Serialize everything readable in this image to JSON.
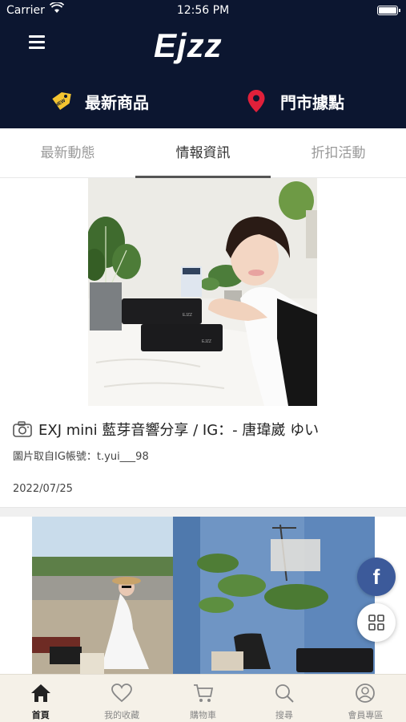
{
  "status_bar": {
    "carrier": "Carrier",
    "time": "12:56 PM"
  },
  "header": {
    "logo_text": "Ejzz",
    "quick_links": [
      {
        "label": "最新商品",
        "icon": "new-tag-icon",
        "badge": "NEW"
      },
      {
        "label": "門市據點",
        "icon": "location-pin-icon"
      }
    ]
  },
  "tabs": [
    {
      "label": "最新動態",
      "active": false
    },
    {
      "label": "情報資訊",
      "active": true
    },
    {
      "label": "折扣活動",
      "active": false
    }
  ],
  "posts": [
    {
      "title": "EXJ mini 藍芽音響分享 / IG：- 唐瑋崴 ゆい",
      "caption": "圖片取自IG帳號：t.yui___98",
      "date": "2022/07/25",
      "icon": "camera-icon"
    }
  ],
  "floating": {
    "facebook_label": "f",
    "grid_icon": "grid-icon"
  },
  "bottom_nav": [
    {
      "label": "首頁",
      "icon": "home-icon",
      "active": true
    },
    {
      "label": "我的收藏",
      "icon": "heart-icon",
      "active": false
    },
    {
      "label": "購物車",
      "icon": "cart-icon",
      "active": false
    },
    {
      "label": "搜尋",
      "icon": "search-icon",
      "active": false
    },
    {
      "label": "會員專區",
      "icon": "user-icon",
      "active": false
    }
  ],
  "colors": {
    "header_bg": "#0c1630",
    "accent_red": "#e0203a",
    "facebook_blue": "#3c5a9a",
    "nav_bg": "#f5f1e8"
  }
}
